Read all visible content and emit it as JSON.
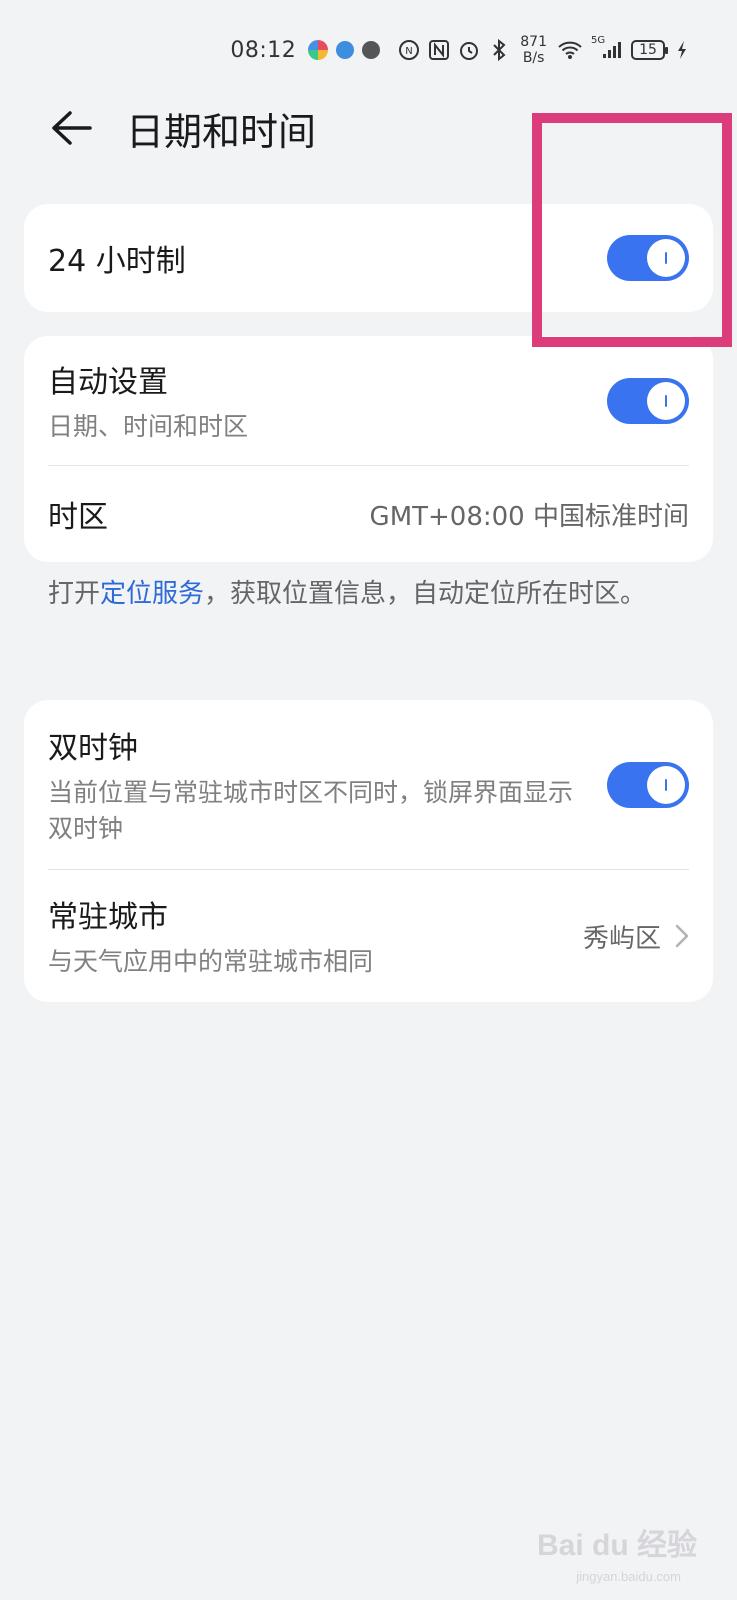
{
  "status_bar": {
    "time": "08:12",
    "net_speed_value": "871",
    "net_speed_unit": "B/s",
    "signal_label": "5G",
    "battery": "15"
  },
  "header": {
    "title": "日期和时间"
  },
  "settings": {
    "hour24": {
      "label": "24 小时制",
      "enabled": true
    },
    "auto_set": {
      "label": "自动设置",
      "subtitle": "日期、时间和时区",
      "enabled": true
    },
    "timezone": {
      "label": "时区",
      "value": "GMT+08:00 中国标准时间"
    },
    "note": {
      "prefix": "打开",
      "link": "定位服务",
      "suffix": "，获取位置信息，自动定位所在时区。"
    },
    "dual_clock": {
      "label": "双时钟",
      "subtitle": "当前位置与常驻城市时区不同时，锁屏界面显示双时钟",
      "enabled": true
    },
    "home_city": {
      "label": "常驻城市",
      "subtitle": "与天气应用中的常驻城市相同",
      "value": "秀屿区"
    }
  },
  "watermark": {
    "text": "Bai du 经验",
    "sub": "jingyan.baidu.com"
  },
  "colors": {
    "accent": "#3a73f0",
    "link": "#2f6bd8",
    "highlight": "#dc3d7a",
    "background": "#f1f3f5"
  }
}
